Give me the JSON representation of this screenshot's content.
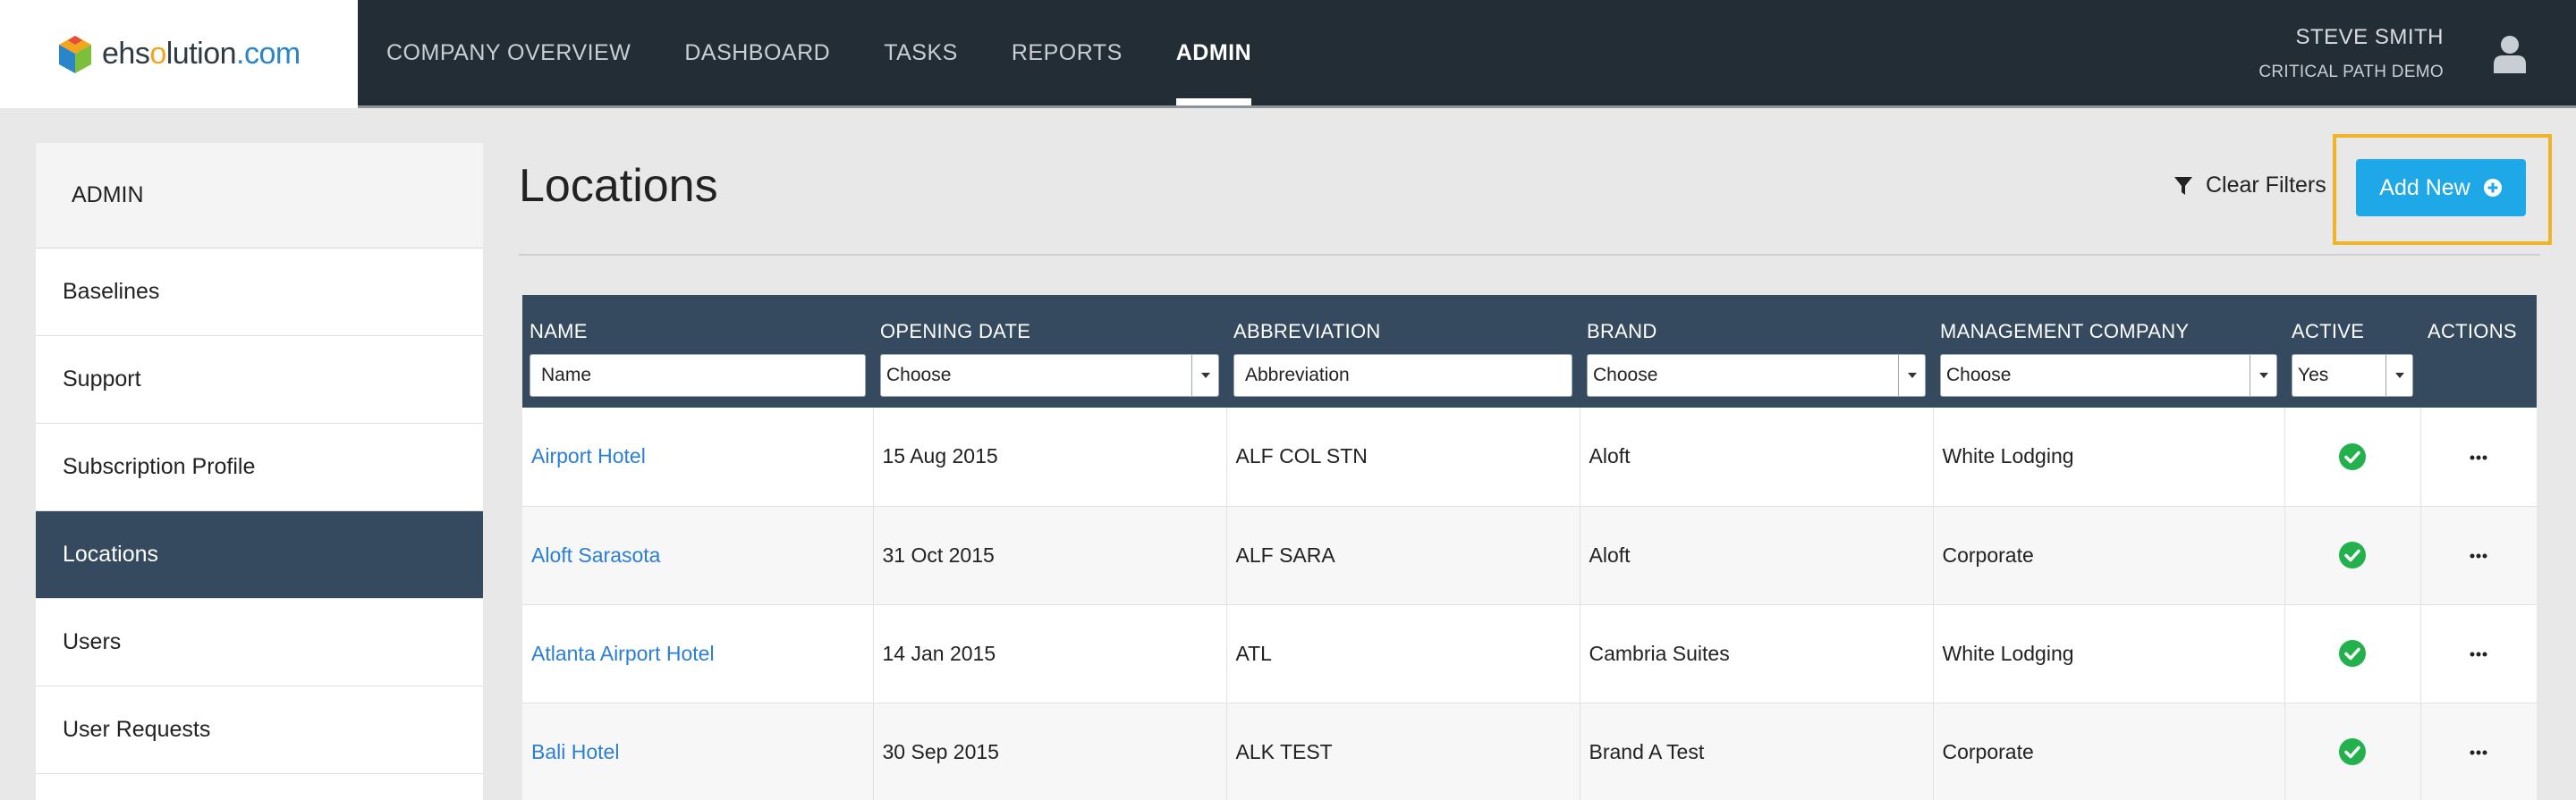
{
  "brand": {
    "logo_parts": [
      "ehs",
      "o",
      "lution",
      ".com"
    ],
    "logo_icon": "cube-logo-icon"
  },
  "nav": {
    "items": [
      {
        "label": "COMPANY OVERVIEW",
        "active": false
      },
      {
        "label": "DASHBOARD",
        "active": false
      },
      {
        "label": "TASKS",
        "active": false
      },
      {
        "label": "REPORTS",
        "active": false
      },
      {
        "label": "ADMIN",
        "active": true
      }
    ]
  },
  "user": {
    "name": "STEVE SMITH",
    "company": "CRITICAL PATH DEMO",
    "avatar_icon": "user-avatar-icon"
  },
  "sidebar": {
    "title": "ADMIN",
    "items": [
      {
        "label": "Baselines",
        "active": false
      },
      {
        "label": "Support",
        "active": false
      },
      {
        "label": "Subscription Profile",
        "active": false
      },
      {
        "label": "Locations",
        "active": true
      },
      {
        "label": "Users",
        "active": false
      },
      {
        "label": "User Requests",
        "active": false
      }
    ]
  },
  "main": {
    "title": "Locations",
    "clear_filters_label": "Clear Filters",
    "add_new_label": "Add New"
  },
  "table": {
    "columns": [
      {
        "label": "NAME",
        "filter_type": "input",
        "filter_value": "Name"
      },
      {
        "label": "OPENING DATE",
        "filter_type": "select",
        "filter_value": "Choose"
      },
      {
        "label": "ABBREVIATION",
        "filter_type": "input",
        "filter_value": "Abbreviation"
      },
      {
        "label": "BRAND",
        "filter_type": "select",
        "filter_value": "Choose"
      },
      {
        "label": "MANAGEMENT COMPANY",
        "filter_type": "select",
        "filter_value": "Choose"
      },
      {
        "label": "ACTIVE",
        "filter_type": "select",
        "filter_value": "Yes"
      },
      {
        "label": "ACTIONS",
        "filter_type": "none",
        "filter_value": ""
      }
    ],
    "rows": [
      {
        "name": "Airport Hotel",
        "opening_date": "15 Aug 2015",
        "abbreviation": "ALF COL STN",
        "brand": "Aloft",
        "management_company": "White Lodging",
        "active": true
      },
      {
        "name": "Aloft Sarasota",
        "opening_date": "31 Oct 2015",
        "abbreviation": "ALF SARA",
        "brand": "Aloft",
        "management_company": "Corporate",
        "active": true
      },
      {
        "name": "Atlanta Airport Hotel",
        "opening_date": "14 Jan 2015",
        "abbreviation": "ATL",
        "brand": "Cambria Suites",
        "management_company": "White Lodging",
        "active": true
      },
      {
        "name": "Bali Hotel",
        "opening_date": "30 Sep 2015",
        "abbreviation": "ALK TEST",
        "brand": "Brand A Test",
        "management_company": "Corporate",
        "active": true
      }
    ]
  },
  "colors": {
    "topbar": "#232d36",
    "sidebar_active": "#354a5e",
    "table_header": "#354a5e",
    "link": "#2a7fd4",
    "add_button": "#1fa8e8",
    "highlight_border": "#f0b429",
    "active_check": "#22b14c"
  }
}
